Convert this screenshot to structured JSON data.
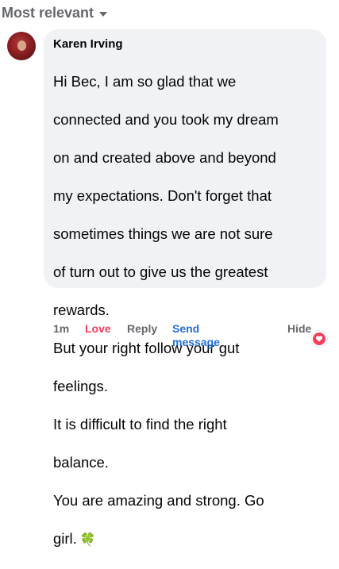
{
  "sort": {
    "label": "Most relevant"
  },
  "comment": {
    "author": "Karen Irving",
    "lines": [
      "Hi Bec, I am so glad that we",
      "connected and you took my dream",
      "on and created above and beyond",
      "my expectations. Don't forget that",
      "sometimes things we are not sure",
      "of turn out to give us the greatest",
      "rewards.",
      "But your right follow your gut",
      "feelings.",
      "It is difficult to find the right",
      "balance.",
      "You are amazing and strong. Go",
      "girl."
    ],
    "emoji": "🍀"
  },
  "actions": {
    "time": "1m",
    "love": "Love",
    "reply": "Reply",
    "send_line1": "Send",
    "send_line2": "message",
    "hide": "Hide"
  },
  "colors": {
    "love": "#f33e58",
    "send": "#216fdb",
    "bubble": "#f0f2f5",
    "meta": "#65676b"
  },
  "icons": {
    "sort": "chevron-down-icon",
    "reaction": "heart-icon"
  }
}
